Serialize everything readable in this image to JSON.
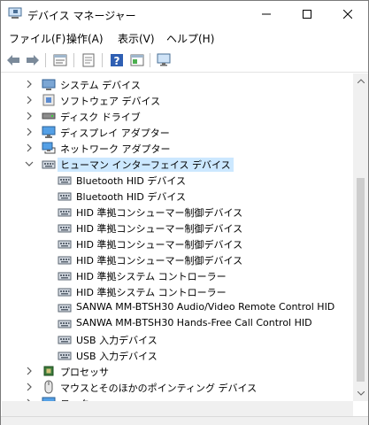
{
  "window": {
    "title": "デバイス マネージャー"
  },
  "menu": {
    "items": [
      "ファイル(F)",
      "操作(A)",
      "表示(V)",
      "ヘルプ(H)"
    ]
  },
  "toolbar": {
    "buttons": [
      "back-icon",
      "forward-icon",
      "properties-icon",
      "update-driver-icon",
      "help-icon",
      "view-icon",
      "monitor-scan-icon"
    ]
  },
  "tree": {
    "categories_top": [
      {
        "label": "システム デバイス",
        "icon": "system-device-icon",
        "expanded": false
      },
      {
        "label": "ソフトウェア デバイス",
        "icon": "software-device-icon",
        "expanded": false
      },
      {
        "label": "ディスク ドライブ",
        "icon": "disk-drive-icon",
        "expanded": false
      },
      {
        "label": "ディスプレイ アダプター",
        "icon": "display-adapter-icon",
        "expanded": false
      },
      {
        "label": "ネットワーク アダプター",
        "icon": "network-adapter-icon",
        "expanded": false
      }
    ],
    "expanded_category": {
      "label": "ヒューマン インターフェイス デバイス",
      "icon": "hid-icon",
      "expanded": true,
      "selected": true
    },
    "hid_devices": [
      "Bluetooth HID デバイス",
      "Bluetooth HID デバイス",
      "HID 準拠コンシューマー制御デバイス",
      "HID 準拠コンシューマー制御デバイス",
      "HID 準拠コンシューマー制御デバイス",
      "HID 準拠コンシューマー制御デバイス",
      "HID 準拠システム コントローラー",
      "HID 準拠システム コントローラー",
      "SANWA MM-BTSH30 Audio/Video Remote Control HID",
      "SANWA MM-BTSH30 Hands-Free Call Control HID",
      "USB 入力デバイス",
      "USB 入力デバイス"
    ],
    "categories_bottom": [
      {
        "label": "プロセッサ",
        "icon": "processor-icon",
        "expanded": false
      },
      {
        "label": "マウスとそのほかのポインティング デバイス",
        "icon": "mouse-icon",
        "expanded": false
      },
      {
        "label": "モニター",
        "icon": "monitor-icon",
        "expanded": false
      }
    ]
  },
  "colors": {
    "selection": "#cce8ff",
    "accent": "#0078d7"
  }
}
